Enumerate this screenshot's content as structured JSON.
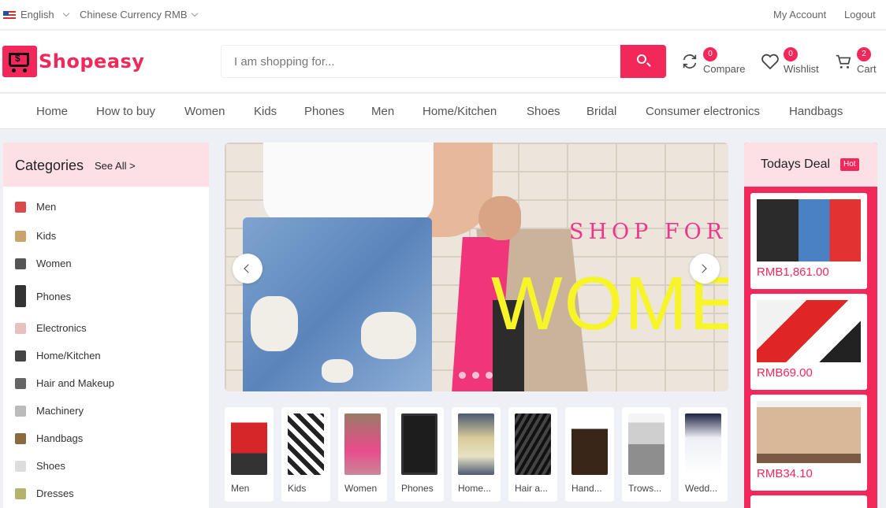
{
  "topbar": {
    "language": "English",
    "currency": "Chinese Currency RMB",
    "my_account": "My Account",
    "logout": "Logout"
  },
  "header": {
    "logo_text": "Shopeasy",
    "search_placeholder": "I am shopping for...",
    "compare": {
      "label": "Compare",
      "count": "0"
    },
    "wishlist": {
      "label": "Wishlist",
      "count": "0"
    },
    "cart": {
      "label": "Cart",
      "count": "2"
    }
  },
  "nav": [
    "Home",
    "How to buy",
    "Women",
    "Kids",
    "Phones",
    "Men",
    "Home/Kitchen",
    "Shoes",
    "Bridal",
    "Consumer electronics",
    "Handbags"
  ],
  "categories": {
    "title": "Categories",
    "see_all": "See All >",
    "items": [
      "Men",
      "Kids",
      "Women",
      "Phones",
      "Electronics",
      "Home/Kitchen",
      "Hair and Makeup",
      "Machinery",
      "Handbags",
      "Shoes",
      "Dresses"
    ]
  },
  "banner": {
    "line1": "SHOP FOR",
    "line2": "WOMEN"
  },
  "thumbs": [
    "Men",
    "Kids",
    "Women",
    "Phones",
    "Home...",
    "Hair a...",
    "Hand...",
    "Trows...",
    "Wedd..."
  ],
  "deal": {
    "title": "Todays Deal",
    "badge": "Hot",
    "items": [
      {
        "price": "RMB1,861.00"
      },
      {
        "price": "RMB69.00"
      },
      {
        "price": "RMB34.10"
      }
    ]
  },
  "colors": {
    "accent": "#f2285b",
    "soft": "#fde0e6"
  }
}
